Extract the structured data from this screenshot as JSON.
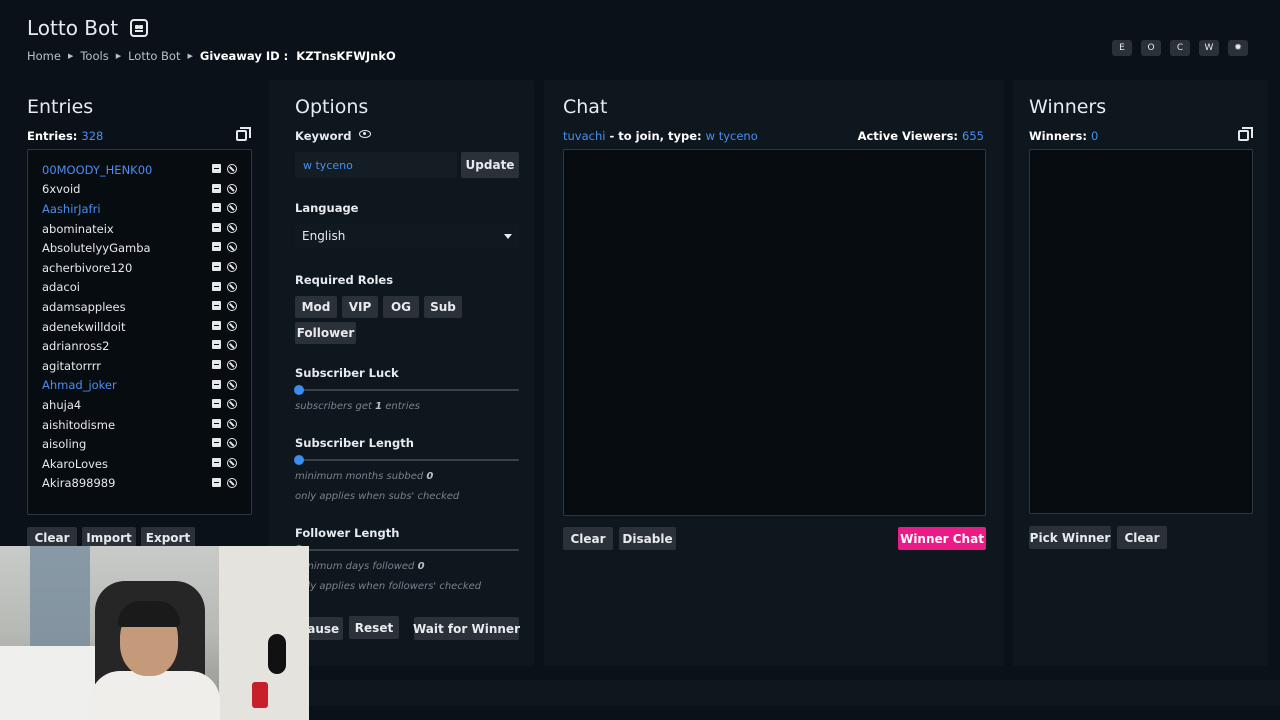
{
  "header": {
    "title": "Lotto Bot",
    "breadcrumb": [
      "Home",
      "Tools",
      "Lotto Bot"
    ],
    "giveaway_label": "Giveaway ID :",
    "giveaway_id": "KZTnsKFWJnkO",
    "toggles": [
      "E",
      "O",
      "C",
      "W",
      "✹"
    ]
  },
  "entries": {
    "title": "Entries",
    "count_label": "Entries:",
    "count": "328",
    "items": [
      {
        "name": "00MOODY_HENK00",
        "highlight": true
      },
      {
        "name": "6xvoid",
        "highlight": false
      },
      {
        "name": "AashirJafri",
        "highlight": true
      },
      {
        "name": "abominateix",
        "highlight": false
      },
      {
        "name": "AbsolutelyyGamba",
        "highlight": false
      },
      {
        "name": "acherbivore120",
        "highlight": false
      },
      {
        "name": "adacoi",
        "highlight": false
      },
      {
        "name": "adamsapplees",
        "highlight": false
      },
      {
        "name": "adenekwilldoit",
        "highlight": false
      },
      {
        "name": "adrianross2",
        "highlight": false
      },
      {
        "name": "agitatorrrr",
        "highlight": false
      },
      {
        "name": "Ahmad_joker",
        "highlight": true
      },
      {
        "name": "ahuja4",
        "highlight": false
      },
      {
        "name": "aishitodisme",
        "highlight": false
      },
      {
        "name": "aisoling",
        "highlight": false
      },
      {
        "name": "AkaroLoves",
        "highlight": false
      },
      {
        "name": "Akira898989",
        "highlight": false
      }
    ],
    "buttons": {
      "clear": "Clear",
      "import": "Import",
      "export": "Export"
    }
  },
  "options": {
    "title": "Options",
    "keyword_label": "Keyword",
    "keyword_value": "w tyceno",
    "update_label": "Update",
    "language_label": "Language",
    "language_value": "English",
    "roles_label": "Required Roles",
    "roles": [
      "Mod",
      "VIP",
      "OG",
      "Sub",
      "Follower"
    ],
    "sub_luck_label": "Subscriber Luck",
    "sub_luck_hint_pre": "subscribers get",
    "sub_luck_value": "1",
    "sub_luck_hint_post": "entries",
    "sub_length_label": "Subscriber Length",
    "sub_length_hint_pre": "minimum months subbed",
    "sub_length_value": "0",
    "sub_length_hint2": "only applies when subs' checked",
    "follower_length_label": "Follower Length",
    "follower_hint_pre": "minimum days followed",
    "follower_value": "0",
    "follower_hint2": "only applies when followers' checked",
    "buttons": {
      "pause": "Pause",
      "reset": "Reset",
      "wait": "Wait for Winner"
    }
  },
  "chat": {
    "title": "Chat",
    "host": "tuvachi",
    "join_text": "- to join, type:",
    "keyword": "w tyceno",
    "viewers_label": "Active Viewers:",
    "viewers": "655",
    "buttons": {
      "clear": "Clear",
      "disable": "Disable",
      "winner_chat": "Winner Chat"
    }
  },
  "winners": {
    "title": "Winners",
    "count_label": "Winners:",
    "count": "0",
    "buttons": {
      "pick": "Pick Winner",
      "clear": "Clear"
    }
  },
  "colors": {
    "accent": "#4a8ef0",
    "pink": "#ea1a86",
    "bg": "#0a1118",
    "panel": "#0e161e"
  }
}
